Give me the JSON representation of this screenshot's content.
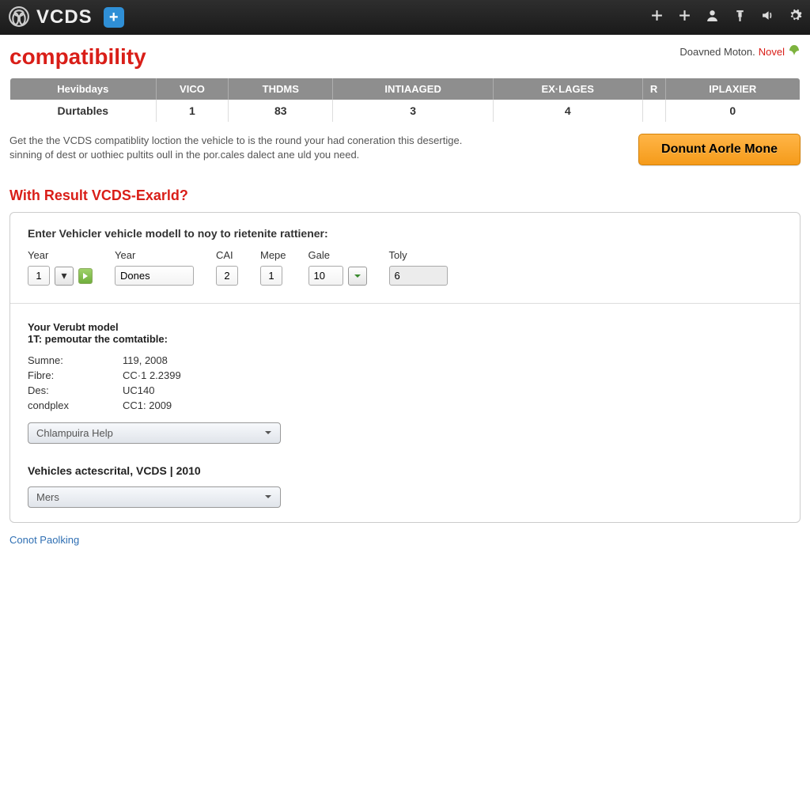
{
  "topbar": {
    "brand": "VCDS"
  },
  "header": {
    "title": "compatibility",
    "right_a": "Doavned Moton.",
    "right_b": "Novel"
  },
  "stats": {
    "headers": [
      "Hevibdays",
      "VICO",
      "THDMS",
      "INTIAAGED",
      "EX·LAGES",
      "R",
      "IPLAXIER"
    ],
    "row": [
      "Durtables",
      "1",
      "83",
      "3",
      "4",
      "",
      "0"
    ]
  },
  "intro": {
    "line1": "Get the the VCDS compatiblity loction the vehicle to is the round your had coneration this desertige.",
    "line2": "sinning of dest or uothiec pultits oull in the por.cales dalect ane uld you need.",
    "cta": "Donunt Aorle Mone"
  },
  "subhead": "With Result VCDS-Exarld?",
  "form": {
    "prompt": "Enter Vehicler vehicle modell to noy to rietenite rattiener:",
    "fields": {
      "year1": {
        "label": "Year",
        "value": "1"
      },
      "year2": {
        "label": "Year",
        "value": "Dones"
      },
      "cai": {
        "label": "CAI",
        "value": "2"
      },
      "mepe": {
        "label": "Mepe",
        "value": "1"
      },
      "gale": {
        "label": "Gale",
        "value": "10"
      },
      "toly": {
        "label": "Toly",
        "value": "6"
      }
    }
  },
  "result": {
    "head": "Your Verubt model",
    "sub": "1T: pemoutar the comtatible:",
    "specs": [
      {
        "k": "Sumne:",
        "v": "119, 2008"
      },
      {
        "k": "Fibre:",
        "v": "CC·1 2.2399"
      },
      {
        "k": "Des:",
        "v": "UC140"
      },
      {
        "k": "condplex",
        "v": "CC1: 2009"
      }
    ],
    "help_dropdown": "Chlampuira Help"
  },
  "vehicles_section": {
    "label": "Vehicles actescrital, VCDS | 2010",
    "dropdown": "Mers"
  },
  "footer_link": "Conot Paolking"
}
